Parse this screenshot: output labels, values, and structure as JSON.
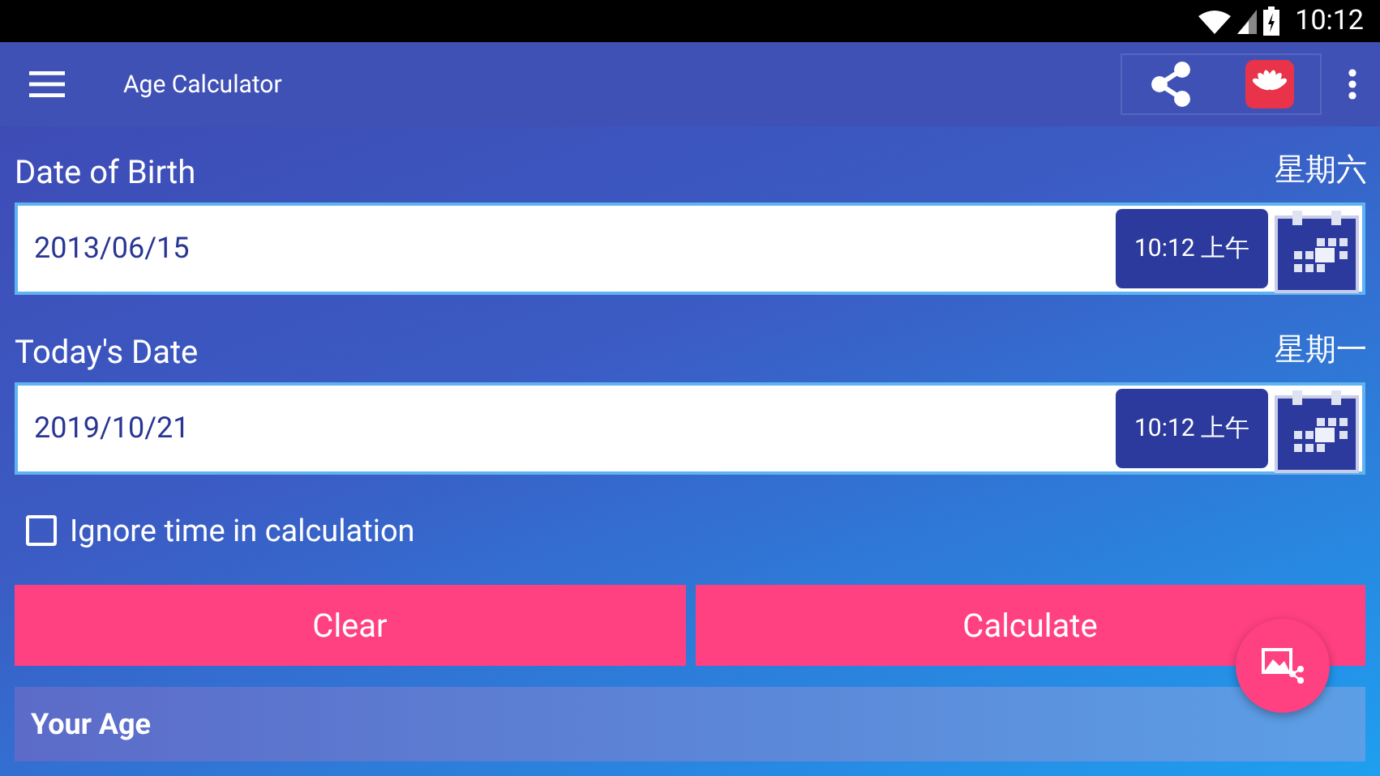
{
  "status_bar": {
    "time": "10:12"
  },
  "app_bar": {
    "title": "Age Calculator"
  },
  "birth": {
    "label": "Date of Birth",
    "weekday": "星期六",
    "date": "2013/06/15",
    "time": "10:12 上午"
  },
  "today": {
    "label": "Today's Date",
    "weekday": "星期一",
    "date": "2019/10/21",
    "time": "10:12 上午"
  },
  "ignore_time": {
    "label": "Ignore time in calculation",
    "checked": false
  },
  "buttons": [
    "Clear",
    "Calculate"
  ],
  "result": {
    "title": "Your Age"
  }
}
